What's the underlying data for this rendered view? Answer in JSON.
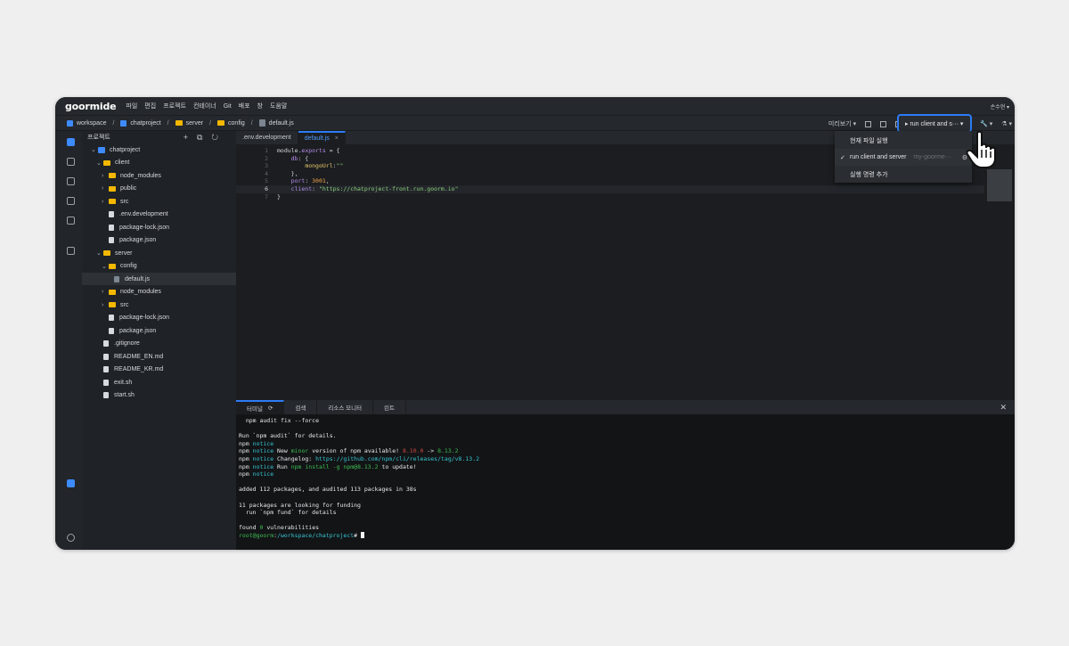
{
  "app": {
    "logo": "goormide",
    "menu": [
      "파일",
      "편집",
      "프로젝트",
      "컨테이너",
      "Git",
      "배포",
      "창",
      "도움말"
    ],
    "user": "손수현 ▾"
  },
  "breadcrumb": [
    "workspace",
    "chatproject",
    "server",
    "config",
    "default.js"
  ],
  "toolbar": {
    "preview_label": "미리보기 ▾",
    "run_label": "▸ run client and s··· ▾",
    "wrench": "🔧 ▾",
    "flask": "⚗ ▾"
  },
  "run_menu": {
    "items": [
      {
        "label": "현재 파일 실행",
        "checked": false,
        "sub": ""
      },
      {
        "label": "run client and server",
        "checked": true,
        "sub": "my-goorme···"
      },
      {
        "label": "실행 명령 추가",
        "checked": false,
        "sub": ""
      }
    ]
  },
  "sidebar": {
    "title": "프로젝트",
    "tree": [
      {
        "label": "chatproject",
        "type": "project",
        "depth": 0,
        "open": true
      },
      {
        "label": "client",
        "type": "folder",
        "depth": 1,
        "open": true
      },
      {
        "label": "node_modules",
        "type": "folder",
        "depth": 2,
        "open": false
      },
      {
        "label": "public",
        "type": "folder",
        "depth": 2,
        "open": false
      },
      {
        "label": "src",
        "type": "folder",
        "depth": 2,
        "open": false
      },
      {
        "label": ".env.development",
        "type": "file",
        "depth": 2
      },
      {
        "label": "package-lock.json",
        "type": "file",
        "depth": 2
      },
      {
        "label": "package.json",
        "type": "file",
        "depth": 2
      },
      {
        "label": "server",
        "type": "folder",
        "depth": 1,
        "open": true
      },
      {
        "label": "config",
        "type": "folder",
        "depth": 2,
        "open": true
      },
      {
        "label": "default.js",
        "type": "jsfile",
        "depth": 3,
        "selected": true
      },
      {
        "label": "node_modules",
        "type": "folder",
        "depth": 2,
        "open": false
      },
      {
        "label": "src",
        "type": "folder",
        "depth": 2,
        "open": false
      },
      {
        "label": "package-lock.json",
        "type": "file",
        "depth": 2
      },
      {
        "label": "package.json",
        "type": "file",
        "depth": 2
      },
      {
        "label": ".gitignore",
        "type": "file",
        "depth": 1
      },
      {
        "label": "README_EN.md",
        "type": "file",
        "depth": 1
      },
      {
        "label": "README_KR.md",
        "type": "file",
        "depth": 1
      },
      {
        "label": "exit.sh",
        "type": "file",
        "depth": 1
      },
      {
        "label": "start.sh",
        "type": "file",
        "depth": 1
      }
    ]
  },
  "editor": {
    "tabs": [
      {
        "label": ".env.development",
        "active": false
      },
      {
        "label": "default.js",
        "active": true
      }
    ],
    "lines": [
      "1",
      "2",
      "3",
      "4",
      "5",
      "6",
      "7"
    ]
  },
  "panel": {
    "tabs": [
      "터미널",
      "검색",
      "리소스 모니터",
      "린트"
    ],
    "terminal": [
      "  npm audit fix --force",
      "",
      "Run `npm audit` for details.",
      "npm notice",
      "npm notice New minor version of npm available! 8.10.0 -> 8.13.2",
      "npm notice Changelog: https://github.com/npm/cli/releases/tag/v8.13.2",
      "npm notice Run npm install -g npm@8.13.2 to update!",
      "npm notice",
      "",
      "added 112 packages, and audited 113 packages in 38s",
      "",
      "11 packages are looking for funding",
      "  run `npm fund` for details",
      "",
      "found 0 vulnerabilities",
      "root@goorm:/workspace/chatproject#"
    ]
  },
  "colors": {
    "accent": "#2d7cf6",
    "folder": "#f5b800",
    "bg": "#1b1d20"
  }
}
